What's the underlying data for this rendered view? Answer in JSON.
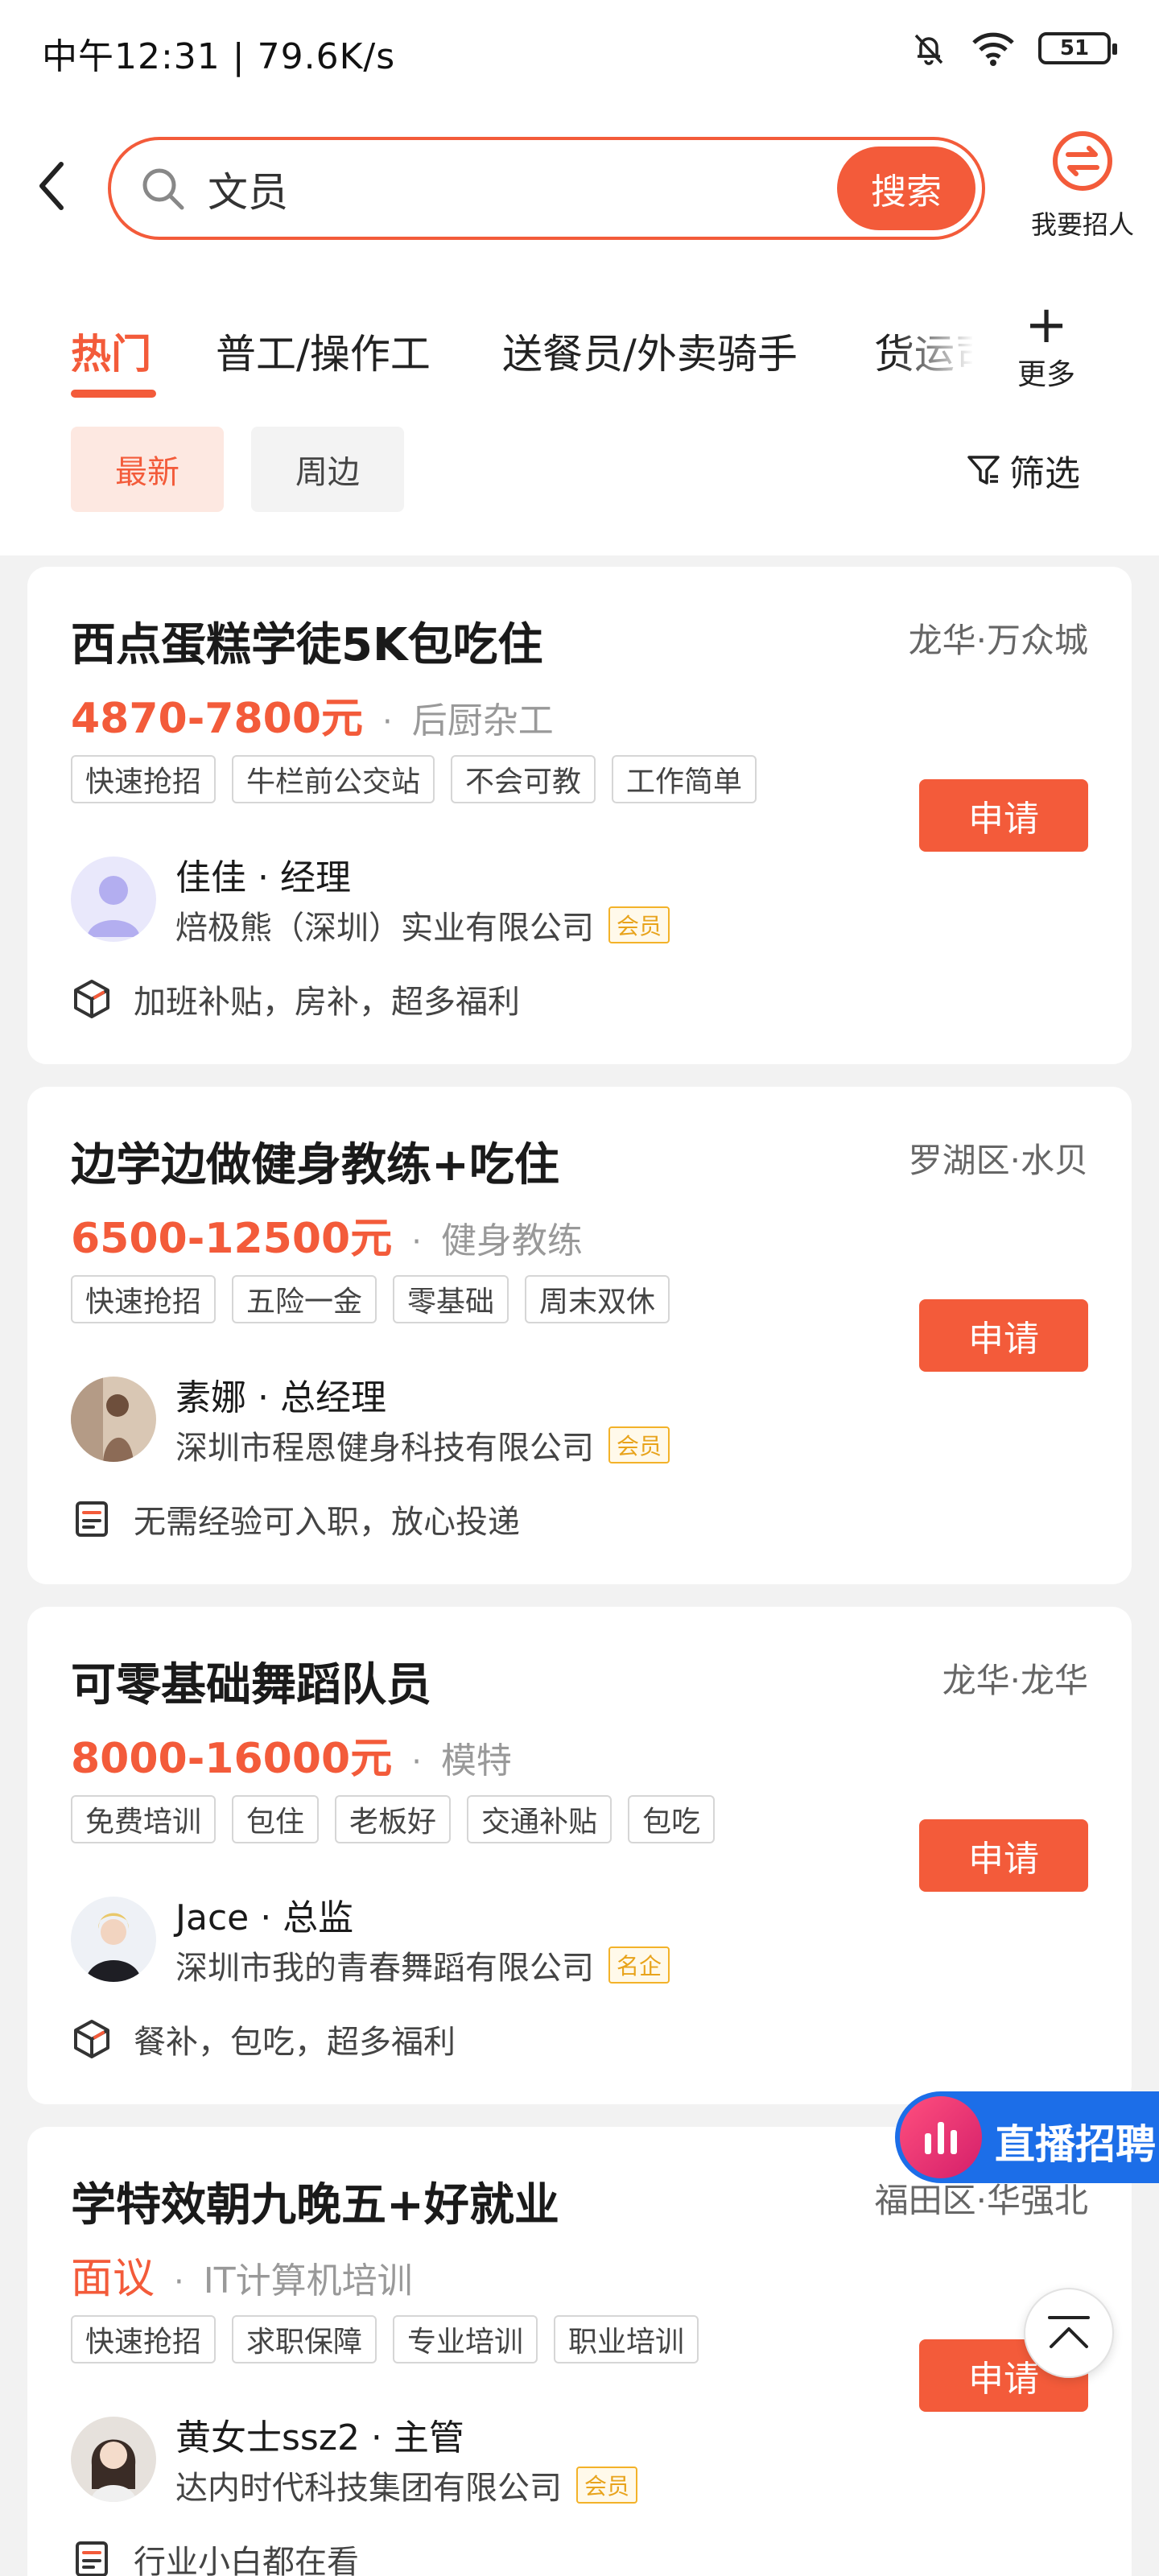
{
  "status_bar": {
    "time_speed": "中午12:31 | 79.6K/s",
    "battery": "51"
  },
  "search": {
    "value": "文员",
    "button": "搜索"
  },
  "recruit": {
    "label": "我要招人"
  },
  "tabs": [
    "热门",
    "普工/操作工",
    "送餐员/外卖骑手",
    "货运司机"
  ],
  "more": {
    "label": "更多"
  },
  "filters": {
    "latest": "最新",
    "nearby": "周边",
    "filter": "筛选"
  },
  "jobs": [
    {
      "title": "西点蛋糕学徒5K包吃住",
      "location": "龙华·万众城",
      "salary": "4870-7800元",
      "category": "后厨杂工",
      "tags": [
        "快速抢招",
        "牛栏前公交站",
        "不会可教",
        "工作简单"
      ],
      "apply": "申请",
      "person": "佳佳 · 经理",
      "company": "焙极熊（深圳）实业有限公司",
      "badge": "会员",
      "benefit_icon": "box-icon",
      "benefit": "加班补贴，房补，超多福利"
    },
    {
      "title": "边学边做健身教练+吃住",
      "location": "罗湖区·水贝",
      "salary": "6500-12500元",
      "category": "健身教练",
      "tags": [
        "快速抢招",
        "五险一金",
        "零基础",
        "周末双休"
      ],
      "apply": "申请",
      "person": "素娜 · 总经理",
      "company": "深圳市程恩健身科技有限公司",
      "badge": "会员",
      "benefit_icon": "document-icon",
      "benefit": "无需经验可入职，放心投递"
    },
    {
      "title": "可零基础舞蹈队员",
      "location": "龙华·龙华",
      "salary": "8000-16000元",
      "category": "模特",
      "tags": [
        "免费培训",
        "包住",
        "老板好",
        "交通补贴",
        "包吃"
      ],
      "apply": "申请",
      "person": "Jace · 总监",
      "company": "深圳市我的青春舞蹈有限公司",
      "badge": "名企",
      "benefit_icon": "box-icon",
      "benefit": "餐补，包吃，超多福利"
    },
    {
      "title": "学特效朝九晚五+好就业",
      "location": "福田区·华强北",
      "salary": "面议",
      "category": "IT计算机培训",
      "tags": [
        "快速抢招",
        "求职保障",
        "专业培训",
        "职业培训"
      ],
      "apply": "申请",
      "person": "黄女士ssz2 · 主管",
      "company": "达内时代科技集团有限公司",
      "badge": "会员",
      "benefit_icon": "document-icon",
      "benefit": "行业小白都在看"
    }
  ],
  "live": {
    "label": "直播招聘"
  },
  "colors": {
    "accent": "#f35b3a",
    "live": "#1c6ee8",
    "badge": "#f3b229"
  }
}
